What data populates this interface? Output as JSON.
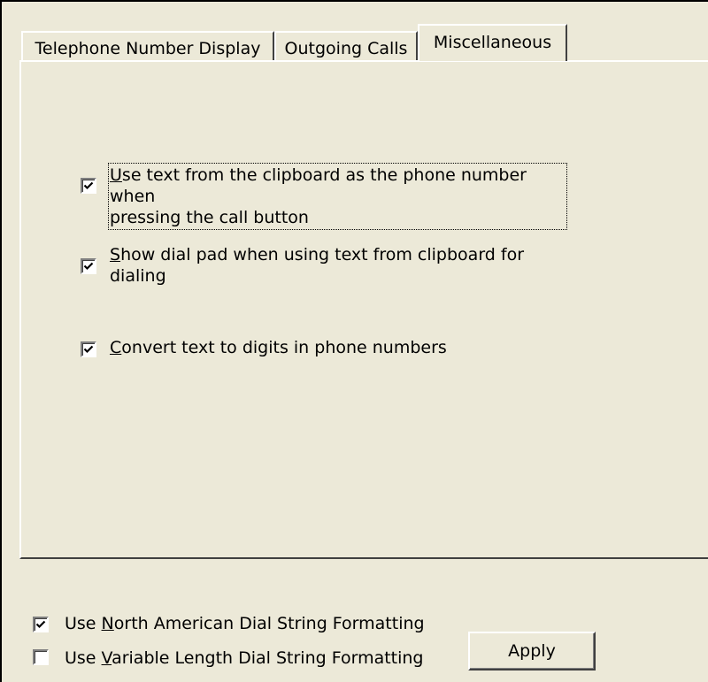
{
  "tabs": [
    {
      "label": "Telephone Number Display",
      "active": false
    },
    {
      "label": "Outgoing Calls",
      "active": false
    },
    {
      "label": "Miscellaneous",
      "active": true
    }
  ],
  "options": [
    {
      "prefix": "",
      "accel": "U",
      "rest_line1": "se text from the clipboard as the phone number when",
      "line2": "pressing the call button",
      "checked": true
    },
    {
      "prefix": "",
      "accel": "S",
      "rest_line1": "how dial pad when using text from clipboard for",
      "line2": "dialing",
      "checked": true
    },
    {
      "prefix": "",
      "accel": "C",
      "rest_line1": "onvert text to digits in phone numbers",
      "line2": "",
      "checked": true
    }
  ],
  "footer": {
    "north_american": {
      "prefix": "Use ",
      "accel": "N",
      "rest": "orth American Dial String Formatting",
      "checked": true
    },
    "variable_length": {
      "prefix": "Use ",
      "accel": "V",
      "rest": "ariable Length Dial String Formatting",
      "checked": false
    },
    "apply_label": "Apply"
  }
}
